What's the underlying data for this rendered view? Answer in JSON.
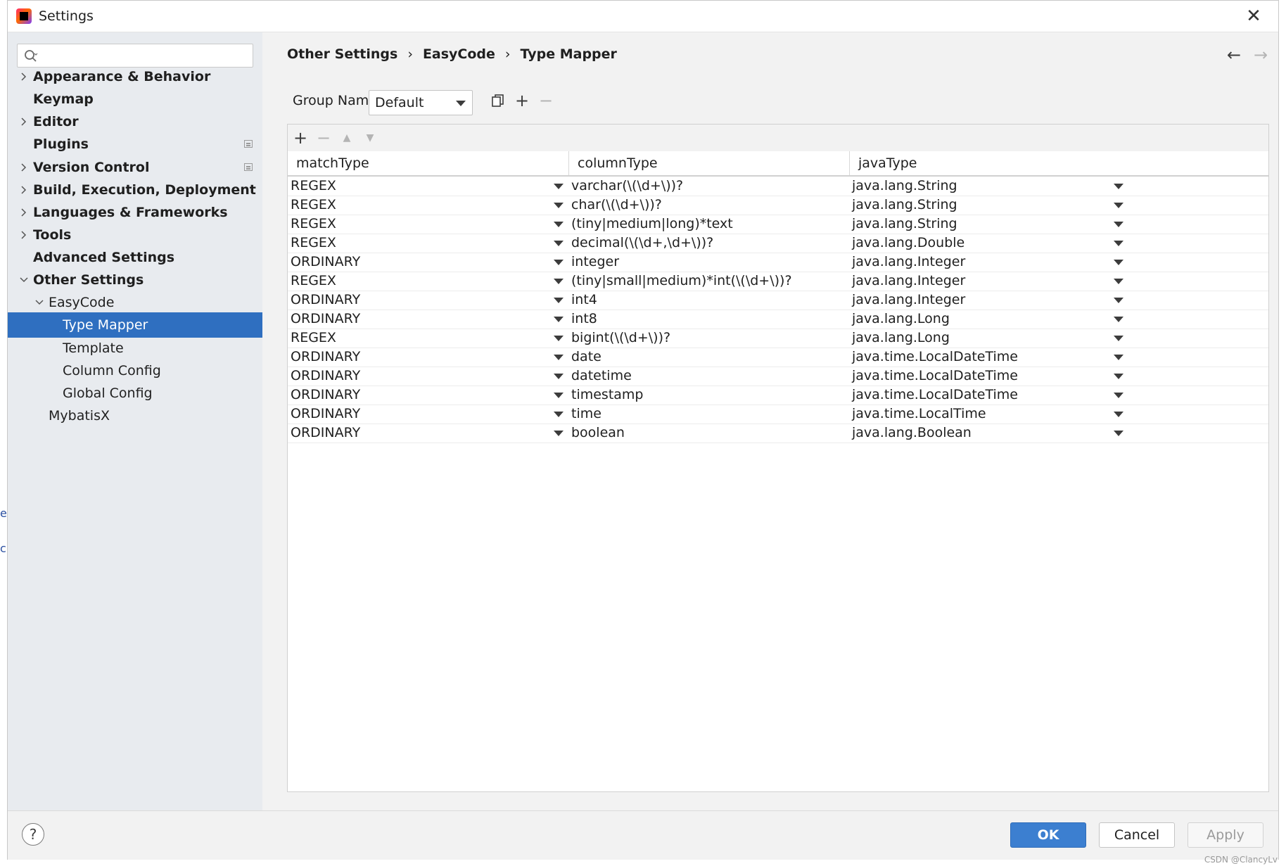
{
  "window": {
    "title": "Settings",
    "close_label": "✕"
  },
  "sidebar": {
    "search_placeholder": "",
    "items": [
      {
        "label": "Appearance & Behavior",
        "level": 0,
        "expandable": true,
        "expanded": false,
        "bold": true
      },
      {
        "label": "Keymap",
        "level": 0,
        "expandable": false,
        "bold": true
      },
      {
        "label": "Editor",
        "level": 0,
        "expandable": true,
        "expanded": false,
        "bold": true
      },
      {
        "label": "Plugins",
        "level": 0,
        "expandable": false,
        "bold": true,
        "project_icon": true
      },
      {
        "label": "Version Control",
        "level": 0,
        "expandable": true,
        "expanded": false,
        "bold": true,
        "project_icon": true
      },
      {
        "label": "Build, Execution, Deployment",
        "level": 0,
        "expandable": true,
        "expanded": false,
        "bold": true
      },
      {
        "label": "Languages & Frameworks",
        "level": 0,
        "expandable": true,
        "expanded": false,
        "bold": true
      },
      {
        "label": "Tools",
        "level": 0,
        "expandable": true,
        "expanded": false,
        "bold": true
      },
      {
        "label": "Advanced Settings",
        "level": 0,
        "expandable": false,
        "bold": true
      },
      {
        "label": "Other Settings",
        "level": 0,
        "expandable": true,
        "expanded": true,
        "bold": true
      },
      {
        "label": "EasyCode",
        "level": 1,
        "expandable": true,
        "expanded": true,
        "bold": false
      },
      {
        "label": "Type Mapper",
        "level": 2,
        "expandable": false,
        "bold": false,
        "selected": true
      },
      {
        "label": "Template",
        "level": 2,
        "expandable": false,
        "bold": false
      },
      {
        "label": "Column Config",
        "level": 2,
        "expandable": false,
        "bold": false
      },
      {
        "label": "Global Config",
        "level": 2,
        "expandable": false,
        "bold": false
      },
      {
        "label": "MybatisX",
        "level": 1,
        "expandable": false,
        "bold": false
      }
    ]
  },
  "breadcrumb": [
    "Other Settings",
    "EasyCode",
    "Type Mapper"
  ],
  "group": {
    "label": "Group Name:",
    "value": "Default"
  },
  "table": {
    "columns": [
      "matchType",
      "columnType",
      "javaType"
    ],
    "rows": [
      [
        "REGEX",
        "varchar(\\(\\d+\\))?",
        "java.lang.String"
      ],
      [
        "REGEX",
        "char(\\(\\d+\\))?",
        "java.lang.String"
      ],
      [
        "REGEX",
        "(tiny|medium|long)*text",
        "java.lang.String"
      ],
      [
        "REGEX",
        "decimal(\\(\\d+,\\d+\\))?",
        "java.lang.Double"
      ],
      [
        "ORDINARY",
        "integer",
        "java.lang.Integer"
      ],
      [
        "REGEX",
        "(tiny|small|medium)*int(\\(\\d+\\))?",
        "java.lang.Integer"
      ],
      [
        "ORDINARY",
        "int4",
        "java.lang.Integer"
      ],
      [
        "ORDINARY",
        "int8",
        "java.lang.Long"
      ],
      [
        "REGEX",
        "bigint(\\(\\d+\\))?",
        "java.lang.Long"
      ],
      [
        "ORDINARY",
        "date",
        "java.time.LocalDateTime"
      ],
      [
        "ORDINARY",
        "datetime",
        "java.time.LocalDateTime"
      ],
      [
        "ORDINARY",
        "timestamp",
        "java.time.LocalDateTime"
      ],
      [
        "ORDINARY",
        "time",
        "java.time.LocalTime"
      ],
      [
        "ORDINARY",
        "boolean",
        "java.lang.Boolean"
      ]
    ]
  },
  "buttons": {
    "ok": "OK",
    "cancel": "Cancel",
    "apply": "Apply",
    "help": "?"
  },
  "watermark": "CSDN @ClancyLv",
  "colors": {
    "selection": "#2f6fc0",
    "ok_button": "#3c7fd0"
  }
}
